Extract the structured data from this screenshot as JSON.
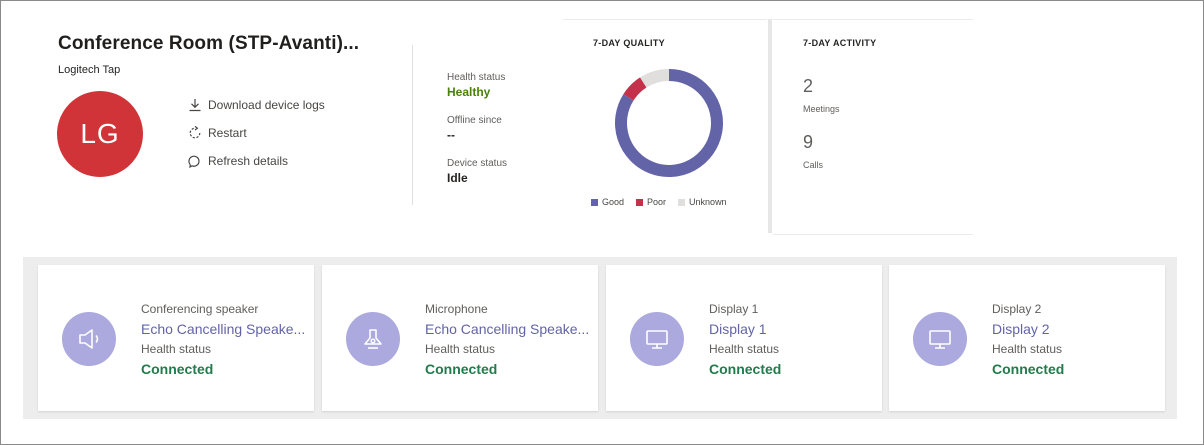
{
  "device": {
    "title": "Conference Room (STP-Avanti)...",
    "model": "Logitech Tap",
    "initials": "LG",
    "avatar_color": "#d13438"
  },
  "actions": [
    {
      "label": "Download device logs",
      "icon": "download-icon"
    },
    {
      "label": "Restart",
      "icon": "restart-icon"
    },
    {
      "label": "Refresh details",
      "icon": "refresh-icon"
    }
  ],
  "status": {
    "health_label": "Health status",
    "health_value": "Healthy",
    "offline_label": "Offline since",
    "offline_value": "--",
    "device_label": "Device status",
    "device_value": "Idle"
  },
  "quality": {
    "heading": "7-DAY QUALITY",
    "chart_data": {
      "type": "pie",
      "categories": [
        "Good",
        "Poor",
        "Unknown"
      ],
      "values": [
        84,
        7,
        9
      ],
      "colors": [
        "#6264a7",
        "#c4314b",
        "#e1dfdd"
      ],
      "legend": "bottom"
    }
  },
  "activity": {
    "heading": "7-DAY ACTIVITY",
    "meetings_value": "2",
    "meetings_label": "Meetings",
    "calls_value": "9",
    "calls_label": "Calls"
  },
  "peripherals": [
    {
      "type": "Conferencing speaker",
      "name": "Echo Cancelling Speake...",
      "health_label": "Health status",
      "health_value": "Connected",
      "icon": "speaker-icon"
    },
    {
      "type": "Microphone",
      "name": "Echo Cancelling Speake...",
      "health_label": "Health status",
      "health_value": "Connected",
      "icon": "microphone-icon"
    },
    {
      "type": "Display 1",
      "name": "Display 1",
      "health_label": "Health status",
      "health_value": "Connected",
      "icon": "monitor-icon"
    },
    {
      "type": "Display 2",
      "name": "Display 2",
      "health_label": "Health status",
      "health_value": "Connected",
      "icon": "monitor-icon"
    }
  ],
  "colors": {
    "accent": "#6264a7",
    "connected": "#237b4b",
    "healthy": "#498205",
    "icon_circle": "#aba9de"
  }
}
